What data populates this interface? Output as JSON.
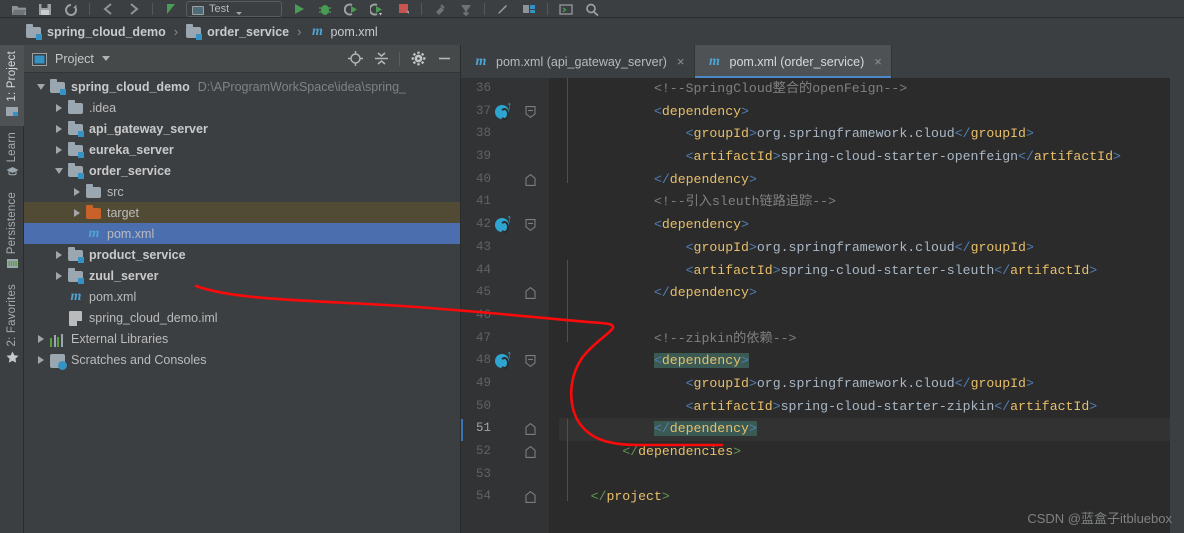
{
  "toolbar": {
    "icons": [
      "open-folder-icon",
      "save-all-icon",
      "sync-refresh-icon",
      "undo-icon",
      "redo-icon",
      "run-anything-icon"
    ],
    "run_config_label": "Test",
    "right_icons": [
      "run-icon",
      "debug-icon",
      "run-with-coverage-icon",
      "profile-icon",
      "stop-icon",
      "build-icon",
      "update-project-icon",
      "edit-icon",
      "structure-icon",
      "terminal-icon",
      "search-icon"
    ]
  },
  "breadcrumb": {
    "items": [
      {
        "label": "spring_cloud_demo",
        "icon": "module-folder-icon",
        "bold": true
      },
      {
        "label": "order_service",
        "icon": "module-folder-icon",
        "bold": true
      },
      {
        "label": "pom.xml",
        "icon": "maven-m-icon",
        "bold": false
      }
    ],
    "separator": "›"
  },
  "side_tabs": [
    {
      "label": "1: Project",
      "icon": "project-icon",
      "active": true
    },
    {
      "label": "Learn",
      "icon": "learn-icon",
      "active": false
    },
    {
      "label": "Persistence",
      "icon": "persistence-icon",
      "active": false
    },
    {
      "label": "2: Favorites",
      "icon": "favorites-star-icon",
      "active": false
    }
  ],
  "project_panel": {
    "title": "Project",
    "actions": [
      "locate-icon",
      "collapse-all-icon",
      "settings-gear-icon",
      "hide-minimize-icon"
    ],
    "tree": [
      {
        "depth": 0,
        "arrow": "down",
        "icon": "module-folder-icon",
        "label": "spring_cloud_demo",
        "bold": true,
        "path": "D:\\AProgramWorkSpace\\idea\\spring_",
        "state": "normal"
      },
      {
        "depth": 1,
        "arrow": "right",
        "icon": "folder-icon",
        "label": ".idea",
        "bold": false,
        "path": "",
        "state": "normal"
      },
      {
        "depth": 1,
        "arrow": "right",
        "icon": "module-folder-icon",
        "label": "api_gateway_server",
        "bold": true,
        "path": "",
        "state": "normal"
      },
      {
        "depth": 1,
        "arrow": "right",
        "icon": "module-folder-icon",
        "label": "eureka_server",
        "bold": true,
        "path": "",
        "state": "normal"
      },
      {
        "depth": 1,
        "arrow": "down",
        "icon": "module-folder-icon",
        "label": "order_service",
        "bold": true,
        "path": "",
        "state": "normal"
      },
      {
        "depth": 2,
        "arrow": "right",
        "icon": "folder-icon",
        "label": "src",
        "bold": false,
        "path": "",
        "state": "normal"
      },
      {
        "depth": 2,
        "arrow": "right",
        "icon": "folder-orange-icon",
        "label": "target",
        "bold": false,
        "path": "",
        "state": "target"
      },
      {
        "depth": 2,
        "arrow": "none",
        "icon": "maven-m-icon",
        "label": "pom.xml",
        "bold": false,
        "path": "",
        "state": "selected"
      },
      {
        "depth": 1,
        "arrow": "right",
        "icon": "module-folder-icon",
        "label": "product_service",
        "bold": true,
        "path": "",
        "state": "normal"
      },
      {
        "depth": 1,
        "arrow": "right",
        "icon": "module-folder-icon",
        "label": "zuul_server",
        "bold": true,
        "path": "",
        "state": "normal"
      },
      {
        "depth": 1,
        "arrow": "none",
        "icon": "maven-m-icon",
        "label": "pom.xml",
        "bold": false,
        "path": "",
        "state": "normal"
      },
      {
        "depth": 1,
        "arrow": "none",
        "icon": "iml-file-icon",
        "label": "spring_cloud_demo.iml",
        "bold": false,
        "path": "",
        "state": "normal"
      },
      {
        "depth": 0,
        "arrow": "right",
        "icon": "external-libraries-icon",
        "label": "External Libraries",
        "bold": false,
        "path": "",
        "state": "normal"
      },
      {
        "depth": 0,
        "arrow": "right",
        "icon": "scratches-icon",
        "label": "Scratches and Consoles",
        "bold": false,
        "path": "",
        "state": "normal"
      }
    ]
  },
  "editor": {
    "tabs": [
      {
        "label": "pom.xml (api_gateway_server)",
        "icon": "maven-m-icon",
        "active": false,
        "close": "×"
      },
      {
        "label": "pom.xml (order_service)",
        "icon": "maven-m-icon",
        "active": true,
        "close": "×"
      }
    ],
    "first_line_number": 36,
    "lines": [
      {
        "n": 36,
        "maven": false,
        "fold": "none",
        "current": false,
        "spans": [
          {
            "t": "            ",
            "c": "txt"
          },
          {
            "t": "<!--SpringCloud整合的openFeign-->",
            "c": "cmt"
          }
        ]
      },
      {
        "n": 37,
        "maven": true,
        "fold": "start",
        "current": false,
        "spans": [
          {
            "t": "            ",
            "c": "txt"
          },
          {
            "t": "<",
            "c": "brk-b"
          },
          {
            "t": "dependency",
            "c": "tag"
          },
          {
            "t": ">",
            "c": "brk-b"
          }
        ]
      },
      {
        "n": 38,
        "maven": false,
        "fold": "none",
        "current": false,
        "spans": [
          {
            "t": "                ",
            "c": "txt"
          },
          {
            "t": "<",
            "c": "brk-b"
          },
          {
            "t": "groupId",
            "c": "tag"
          },
          {
            "t": ">",
            "c": "brk-b"
          },
          {
            "t": "org.springframework.cloud",
            "c": "txt"
          },
          {
            "t": "</",
            "c": "brk-b"
          },
          {
            "t": "groupId",
            "c": "tag"
          },
          {
            "t": ">",
            "c": "brk-b"
          }
        ]
      },
      {
        "n": 39,
        "maven": false,
        "fold": "none",
        "current": false,
        "spans": [
          {
            "t": "                ",
            "c": "txt"
          },
          {
            "t": "<",
            "c": "brk-b"
          },
          {
            "t": "artifactId",
            "c": "tag"
          },
          {
            "t": ">",
            "c": "brk-b"
          },
          {
            "t": "spring-cloud-starter-openfeign",
            "c": "txt"
          },
          {
            "t": "</",
            "c": "brk-b"
          },
          {
            "t": "artifactId",
            "c": "tag"
          },
          {
            "t": ">",
            "c": "brk-b"
          }
        ]
      },
      {
        "n": 40,
        "maven": false,
        "fold": "end",
        "current": false,
        "spans": [
          {
            "t": "            ",
            "c": "txt"
          },
          {
            "t": "</",
            "c": "brk-b"
          },
          {
            "t": "dependency",
            "c": "tag"
          },
          {
            "t": ">",
            "c": "brk-b"
          }
        ]
      },
      {
        "n": 41,
        "maven": false,
        "fold": "none",
        "current": false,
        "spans": [
          {
            "t": "            ",
            "c": "txt"
          },
          {
            "t": "<!--引入sleuth链路追踪-->",
            "c": "cmt"
          }
        ]
      },
      {
        "n": 42,
        "maven": true,
        "fold": "start",
        "current": false,
        "spans": [
          {
            "t": "            ",
            "c": "txt"
          },
          {
            "t": "<",
            "c": "brk-b"
          },
          {
            "t": "dependency",
            "c": "tag"
          },
          {
            "t": ">",
            "c": "brk-b"
          }
        ]
      },
      {
        "n": 43,
        "maven": false,
        "fold": "none",
        "current": false,
        "spans": [
          {
            "t": "                ",
            "c": "txt"
          },
          {
            "t": "<",
            "c": "brk-b"
          },
          {
            "t": "groupId",
            "c": "tag"
          },
          {
            "t": ">",
            "c": "brk-b"
          },
          {
            "t": "org.springframework.cloud",
            "c": "txt"
          },
          {
            "t": "</",
            "c": "brk-b"
          },
          {
            "t": "groupId",
            "c": "tag"
          },
          {
            "t": ">",
            "c": "brk-b"
          }
        ]
      },
      {
        "n": 44,
        "maven": false,
        "fold": "none",
        "current": false,
        "spans": [
          {
            "t": "                ",
            "c": "txt"
          },
          {
            "t": "<",
            "c": "brk-b"
          },
          {
            "t": "artifactId",
            "c": "tag"
          },
          {
            "t": ">",
            "c": "brk-b"
          },
          {
            "t": "spring-cloud-starter-sleuth",
            "c": "txt"
          },
          {
            "t": "</",
            "c": "brk-b"
          },
          {
            "t": "artifactId",
            "c": "tag"
          },
          {
            "t": ">",
            "c": "brk-b"
          }
        ]
      },
      {
        "n": 45,
        "maven": false,
        "fold": "end",
        "current": false,
        "spans": [
          {
            "t": "            ",
            "c": "txt"
          },
          {
            "t": "</",
            "c": "brk-b"
          },
          {
            "t": "dependency",
            "c": "tag"
          },
          {
            "t": ">",
            "c": "brk-b"
          }
        ]
      },
      {
        "n": 46,
        "maven": false,
        "fold": "none",
        "current": false,
        "spans": []
      },
      {
        "n": 47,
        "maven": false,
        "fold": "none",
        "current": false,
        "spans": [
          {
            "t": "            ",
            "c": "txt"
          },
          {
            "t": "<!--zipkin的依赖-->",
            "c": "cmt"
          }
        ]
      },
      {
        "n": 48,
        "maven": true,
        "fold": "start",
        "current": false,
        "spans": [
          {
            "t": "            ",
            "c": "txt"
          },
          {
            "t": "<",
            "c": "brk-b hl"
          },
          {
            "t": "dependency",
            "c": "tag hl"
          },
          {
            "t": ">",
            "c": "brk-b hl"
          }
        ]
      },
      {
        "n": 49,
        "maven": false,
        "fold": "none",
        "current": false,
        "spans": [
          {
            "t": "                ",
            "c": "txt"
          },
          {
            "t": "<",
            "c": "brk-b"
          },
          {
            "t": "groupId",
            "c": "tag"
          },
          {
            "t": ">",
            "c": "brk-b"
          },
          {
            "t": "org.springframework.cloud",
            "c": "txt"
          },
          {
            "t": "</",
            "c": "brk-b"
          },
          {
            "t": "groupId",
            "c": "tag"
          },
          {
            "t": ">",
            "c": "brk-b"
          }
        ]
      },
      {
        "n": 50,
        "maven": false,
        "fold": "none",
        "current": false,
        "spans": [
          {
            "t": "                ",
            "c": "txt"
          },
          {
            "t": "<",
            "c": "brk-b"
          },
          {
            "t": "artifactId",
            "c": "tag"
          },
          {
            "t": ">",
            "c": "brk-b"
          },
          {
            "t": "spring-cloud-starter-zipkin",
            "c": "txt"
          },
          {
            "t": "</",
            "c": "brk-b"
          },
          {
            "t": "artifactId",
            "c": "tag"
          },
          {
            "t": ">",
            "c": "brk-b"
          }
        ]
      },
      {
        "n": 51,
        "maven": false,
        "fold": "end",
        "current": true,
        "spans": [
          {
            "t": "            ",
            "c": "txt"
          },
          {
            "t": "</",
            "c": "brk-b hl"
          },
          {
            "t": "dependency",
            "c": "tag hl"
          },
          {
            "t": ">",
            "c": "brk-b hl"
          }
        ]
      },
      {
        "n": 52,
        "maven": false,
        "fold": "end",
        "current": false,
        "spans": [
          {
            "t": "        ",
            "c": "txt"
          },
          {
            "t": "</",
            "c": "brk"
          },
          {
            "t": "dependencies",
            "c": "tag"
          },
          {
            "t": ">",
            "c": "brk"
          }
        ]
      },
      {
        "n": 53,
        "maven": false,
        "fold": "none",
        "current": false,
        "spans": []
      },
      {
        "n": 54,
        "maven": false,
        "fold": "end",
        "current": false,
        "spans": [
          {
            "t": "    ",
            "c": "txt"
          },
          {
            "t": "</",
            "c": "brk"
          },
          {
            "t": "project",
            "c": "tag"
          },
          {
            "t": ">",
            "c": "brk"
          }
        ]
      }
    ]
  },
  "watermark": {
    "text": "CSDN @蓝盒子itbluebox"
  },
  "colors": {
    "accent_blue": "#4b6eaf",
    "maven_cyan": "#2da5d0",
    "highlight_teal": "#3b5a53",
    "annotation_red": "#ff0000",
    "target_folder": "#514b36",
    "editor_bg": "#2b2b2b",
    "panel_bg": "#3c3f41"
  }
}
